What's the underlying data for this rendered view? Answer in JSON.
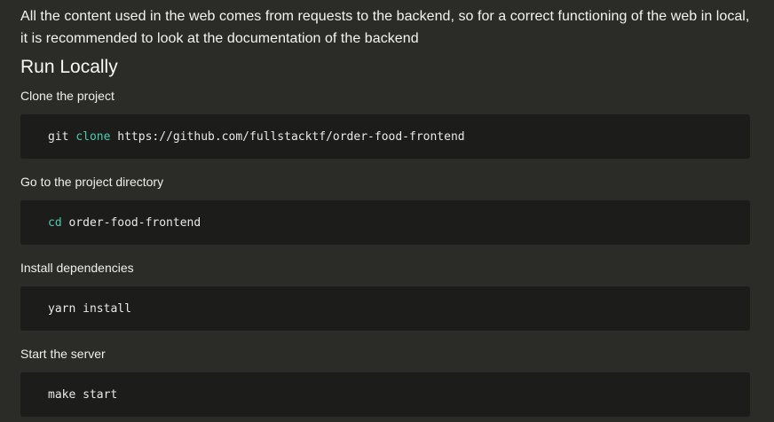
{
  "intro_text": "All the content used in the web comes from requests to the backend, so for a correct functioning of the web in local, it is recommended to look at the documentation of the backend",
  "section_title": "Run Locally",
  "steps": [
    {
      "label": "Clone the project",
      "command_keyword_prefix": "git ",
      "command_keyword": "clone",
      "command_rest": " https://github.com/fullstacktf/order-food-frontend"
    },
    {
      "label": "Go to the project directory",
      "command_keyword": "cd",
      "command_rest": " order-food-frontend"
    },
    {
      "label": "Install dependencies",
      "command": "yarn install"
    },
    {
      "label": "Start the server",
      "command": "make start"
    }
  ],
  "colors": {
    "background": "#2b2b28",
    "code_background": "#1c1c1a",
    "keyword": "#4ec9b0",
    "text": "#f2f2f0"
  }
}
